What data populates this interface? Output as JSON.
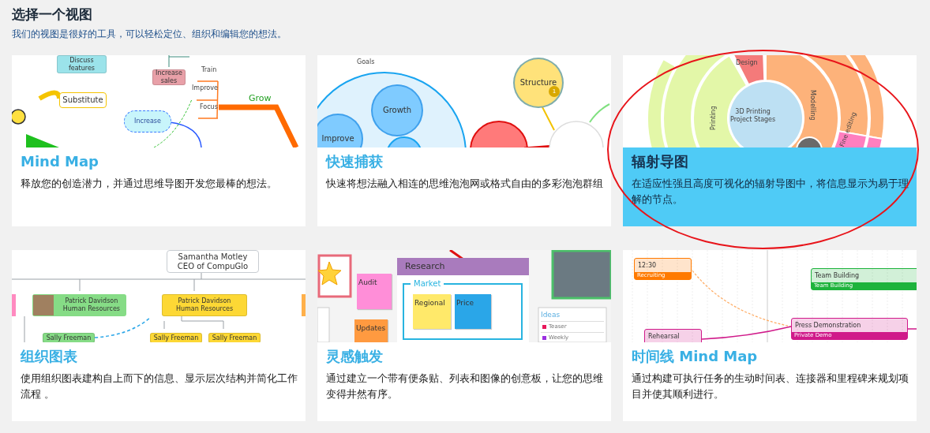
{
  "header": {
    "title": "选择一个视图",
    "subtitle": "我们的视图是很好的工具，可以轻松定位、组织和编辑您的想法。"
  },
  "cards": [
    {
      "title": "Mind Map",
      "description": "释放您的创造潜力，并通过思维导图开发您最棒的想法。",
      "selected": false,
      "circled": false,
      "preview": {
        "kind": "mindmap",
        "items": [
          {
            "kind": "box",
            "text": "Discuss features",
            "color": "#9be3ea"
          },
          {
            "kind": "box",
            "text": "Increase sales",
            "color": "#e8a0a8"
          },
          {
            "kind": "outline",
            "text": "Substitute",
            "color": "#f5c400"
          },
          {
            "kind": "text",
            "text": "Train"
          },
          {
            "kind": "text",
            "text": "Improve"
          },
          {
            "kind": "text",
            "text": "Focus"
          },
          {
            "kind": "branch",
            "text": "Grow"
          },
          {
            "kind": "cloud",
            "text": "Increase",
            "color": "#c8f5fb"
          }
        ]
      }
    },
    {
      "title": "快速捕获",
      "description": "快速将想法融入相连的思维泡泡网或格式自由的多彩泡泡群组",
      "selected": false,
      "circled": false,
      "preview": {
        "kind": "bubbles",
        "items": [
          {
            "kind": "text",
            "text": "Goals"
          },
          {
            "kind": "bubble",
            "text": "Growth",
            "color": "#7fcbff"
          },
          {
            "kind": "bubble",
            "text": "Improve",
            "color": "#7fcbff"
          },
          {
            "kind": "bubble",
            "text": "Structure",
            "color": "#ffe27a"
          },
          {
            "kind": "badge",
            "text": "1",
            "color": "#d8a800"
          }
        ]
      }
    },
    {
      "title": "辐射导图",
      "description": "在适应性强且高度可视化的辐射导图中，将信息显示为易于理解的节点。",
      "selected": true,
      "circled": true,
      "preview": {
        "kind": "sunburst",
        "items": [
          {
            "kind": "text",
            "text": "Design"
          },
          {
            "kind": "text",
            "text": "3D Printing\nProject Stages"
          },
          {
            "kind": "text",
            "text": "Printing"
          },
          {
            "kind": "text",
            "text": "Modelling"
          },
          {
            "kind": "text",
            "text": "Fine editing"
          }
        ]
      }
    },
    {
      "title": "组织图表",
      "description": "使用组织图表建构自上而下的信息、显示层次结构并简化工作流程 。",
      "selected": false,
      "circled": false,
      "preview": {
        "kind": "orgchart",
        "items": [
          {
            "kind": "outline",
            "text": "Samantha Motley\nCEO of CompuGlo",
            "color": "#c8cdd2"
          },
          {
            "kind": "person",
            "text": "Patrick Davidson\nHuman Resources",
            "color": "#86dc86"
          },
          {
            "kind": "box",
            "text": "Patrick Davidson\nHuman Resources",
            "color": "#fdd835"
          },
          {
            "kind": "box",
            "text": "Sally Freeman",
            "color": "#86dc86"
          },
          {
            "kind": "box",
            "text": "Sally Freeman",
            "color": "#fdd835"
          },
          {
            "kind": "box",
            "text": "Sally Freeman",
            "color": "#fdd835"
          }
        ]
      }
    },
    {
      "title": "灵感触发",
      "description": "通过建立一个带有便条贴、列表和图像的创意板，让您的思维变得井然有序。",
      "selected": false,
      "circled": false,
      "preview": {
        "kind": "board",
        "items": [
          {
            "kind": "header",
            "text": "Research",
            "color": "#a97bbd"
          },
          {
            "kind": "sticky",
            "text": "Audit",
            "color": "#ff8ed8"
          },
          {
            "kind": "frame",
            "text": "Market",
            "color": "#28b4e0"
          },
          {
            "kind": "sticky",
            "text": "Regional",
            "color": "#ffe96a"
          },
          {
            "kind": "sticky",
            "text": "Price",
            "color": "#2aa6e8"
          },
          {
            "kind": "sticky",
            "text": "Updates",
            "color": "#ff9a40"
          },
          {
            "kind": "title",
            "text": "Ideas"
          },
          {
            "kind": "bullet",
            "text": "Teaser",
            "color": "#e8185a"
          },
          {
            "kind": "bullet",
            "text": "Weekly",
            "color": "#9b30e0"
          }
        ]
      }
    },
    {
      "title": "时间线 Mind Map",
      "description": "通过构建可执行任务的生动时间表、连接器和里程碑来规划项目并使其顺利进行。",
      "selected": false,
      "circled": false,
      "preview": {
        "kind": "timeline",
        "items": [
          {
            "kind": "event",
            "text": "12:30",
            "sub": "Recruiting",
            "color": "#ff7a00"
          },
          {
            "kind": "event",
            "text": "Team Building",
            "sub": "Team Building",
            "color": "#1db33c"
          },
          {
            "kind": "event",
            "text": "Rehearsal",
            "color": "#d01a8a"
          },
          {
            "kind": "event",
            "text": "Press Demonstration",
            "sub": "Private Demo",
            "color": "#d01a8a"
          }
        ]
      }
    }
  ]
}
